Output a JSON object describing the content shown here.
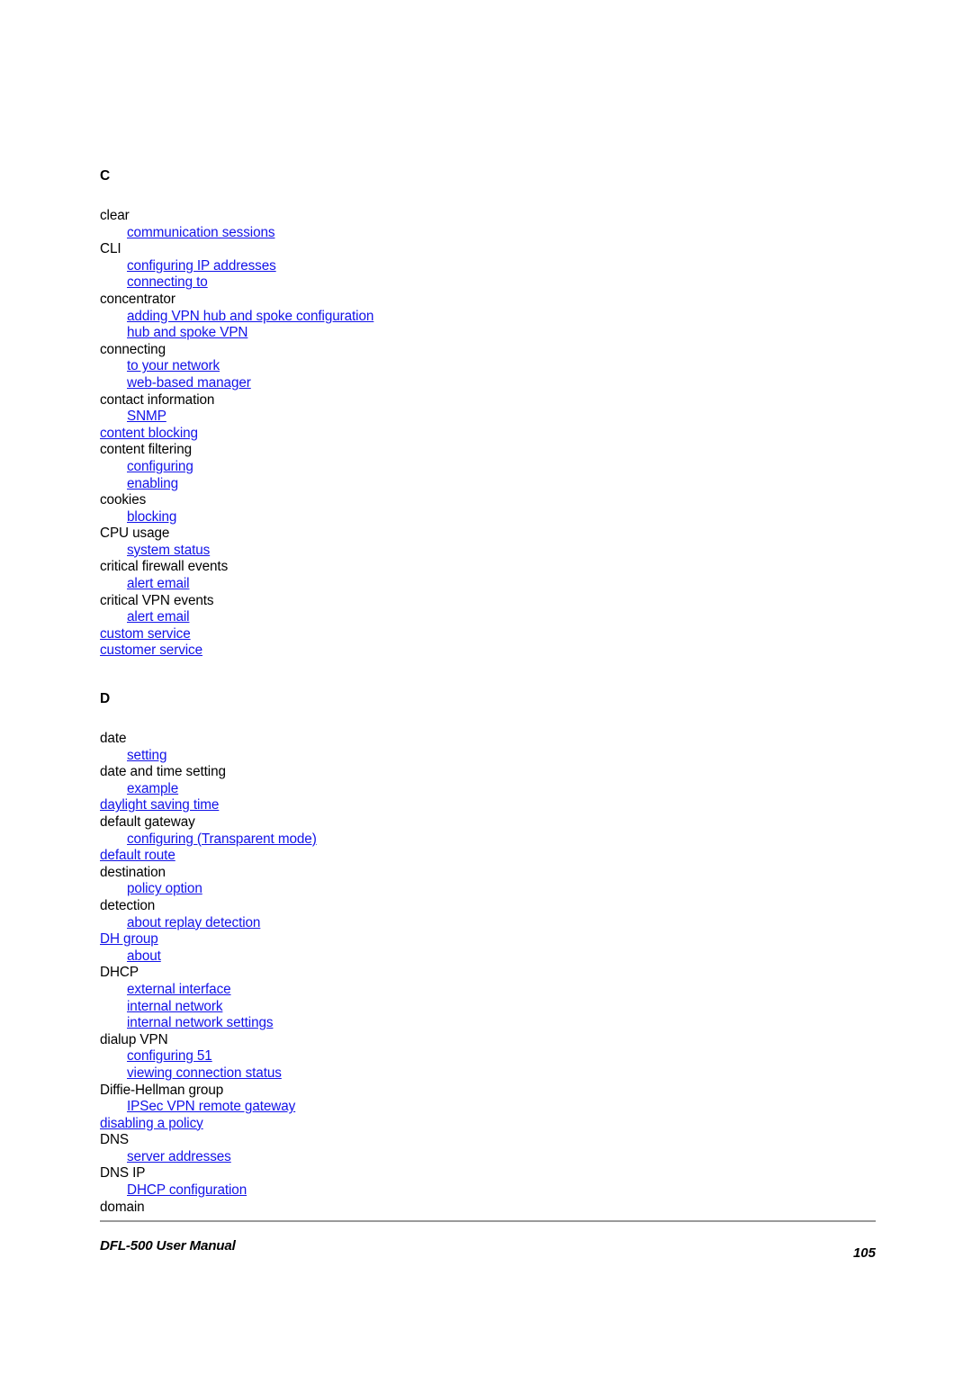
{
  "document": {
    "type": "index-page",
    "footer": {
      "title": "DFL-500 User Manual",
      "page_number": "105"
    },
    "colors": {
      "link": "#1313e8",
      "text": "#000000",
      "rule": "#9a9a9a",
      "background": "#ffffff"
    }
  },
  "sections": [
    {
      "letter": "C",
      "entries": [
        {
          "text": "clear",
          "level": 1,
          "link": false
        },
        {
          "text": "communication sessions",
          "level": 2,
          "link": true
        },
        {
          "text": "CLI",
          "level": 1,
          "link": false
        },
        {
          "text": "configuring IP addresses",
          "level": 2,
          "link": true
        },
        {
          "text": "connecting to",
          "level": 2,
          "link": true
        },
        {
          "text": "concentrator",
          "level": 1,
          "link": false
        },
        {
          "text": "adding VPN hub and spoke configuration",
          "level": 2,
          "link": true
        },
        {
          "text": "hub and spoke VPN",
          "level": 2,
          "link": true
        },
        {
          "text": "connecting",
          "level": 1,
          "link": false
        },
        {
          "text": "to your network",
          "level": 2,
          "link": true
        },
        {
          "text": "web-based manager",
          "level": 2,
          "link": true
        },
        {
          "text": "contact information",
          "level": 1,
          "link": false
        },
        {
          "text": "SNMP",
          "level": 2,
          "link": true
        },
        {
          "text": "content blocking",
          "level": 1,
          "link": true
        },
        {
          "text": "content filtering",
          "level": 1,
          "link": false
        },
        {
          "text": "configuring",
          "level": 2,
          "link": true
        },
        {
          "text": "enabling",
          "level": 2,
          "link": true
        },
        {
          "text": "cookies",
          "level": 1,
          "link": false
        },
        {
          "text": "blocking",
          "level": 2,
          "link": true
        },
        {
          "text": "CPU usage",
          "level": 1,
          "link": false
        },
        {
          "text": "system status",
          "level": 2,
          "link": true
        },
        {
          "text": "critical firewall events",
          "level": 1,
          "link": false
        },
        {
          "text": "alert email",
          "level": 2,
          "link": true
        },
        {
          "text": "critical VPN events",
          "level": 1,
          "link": false
        },
        {
          "text": "alert email",
          "level": 2,
          "link": true
        },
        {
          "text": "custom service",
          "level": 1,
          "link": true
        },
        {
          "text": "customer service",
          "level": 1,
          "link": true
        }
      ]
    },
    {
      "letter": "D",
      "entries": [
        {
          "text": "date",
          "level": 1,
          "link": false
        },
        {
          "text": "setting",
          "level": 2,
          "link": true
        },
        {
          "text": "date and time setting",
          "level": 1,
          "link": false
        },
        {
          "text": "example",
          "level": 2,
          "link": true
        },
        {
          "text": "daylight saving time",
          "level": 1,
          "link": true
        },
        {
          "text": "default gateway",
          "level": 1,
          "link": false
        },
        {
          "text": "configuring (Transparent mode)",
          "level": 2,
          "link": true
        },
        {
          "text": "default route",
          "level": 1,
          "link": true
        },
        {
          "text": "destination",
          "level": 1,
          "link": false
        },
        {
          "text": "policy option",
          "level": 2,
          "link": true
        },
        {
          "text": "detection",
          "level": 1,
          "link": false
        },
        {
          "text": "about replay detection",
          "level": 2,
          "link": true
        },
        {
          "text": "DH group",
          "level": 1,
          "link": true
        },
        {
          "text": "about",
          "level": 2,
          "link": true
        },
        {
          "text": "DHCP",
          "level": 1,
          "link": false
        },
        {
          "text": "external interface",
          "level": 2,
          "link": true
        },
        {
          "text": "internal network",
          "level": 2,
          "link": true
        },
        {
          "text": "internal network settings",
          "level": 2,
          "link": true
        },
        {
          "text": "dialup VPN",
          "level": 1,
          "link": false
        },
        {
          "text": "configuring 51",
          "level": 2,
          "link": true
        },
        {
          "text": "viewing connection status",
          "level": 2,
          "link": true
        },
        {
          "text": "Diffie-Hellman group",
          "level": 1,
          "link": false
        },
        {
          "text": "IPSec VPN remote gateway",
          "level": 2,
          "link": true
        },
        {
          "text": "disabling a policy",
          "level": 1,
          "link": true
        },
        {
          "text": "DNS",
          "level": 1,
          "link": false
        },
        {
          "text": "server addresses",
          "level": 2,
          "link": true
        },
        {
          "text": "DNS IP",
          "level": 1,
          "link": false
        },
        {
          "text": "DHCP configuration",
          "level": 2,
          "link": true
        },
        {
          "text": "domain",
          "level": 1,
          "link": false
        }
      ]
    }
  ]
}
